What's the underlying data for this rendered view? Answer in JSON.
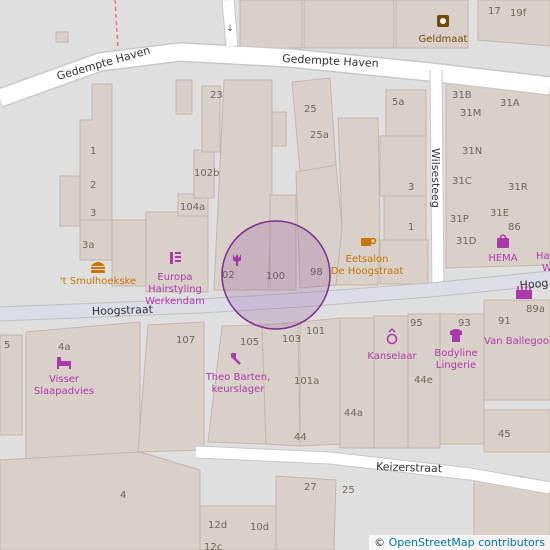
{
  "map": {
    "roads": [
      {
        "name": "Gedempte Haven",
        "label": "Gedempte Haven"
      },
      {
        "name": "Hoogstraat",
        "label": "Hoogstraat"
      },
      {
        "name": "Hoogstraat-east",
        "label": "Hoog"
      },
      {
        "name": "Wilsesteeg",
        "label": "Wilsesteeg"
      },
      {
        "name": "Keizerstraat",
        "label": "Keizerstraat"
      }
    ],
    "house_numbers": [
      "17",
      "19f",
      "23",
      "25",
      "25a",
      "5a",
      "31B",
      "31A",
      "31M",
      "1",
      "2",
      "3",
      "3a",
      "102b",
      "104a",
      "31N",
      "31C",
      "31R",
      "3",
      "1",
      "31P",
      "31E",
      "86",
      "31D",
      "02",
      "100",
      "98",
      "89a",
      "107",
      "105",
      "103",
      "101",
      "95",
      "93",
      "91",
      "5",
      "4a",
      "101a",
      "44e",
      "44a",
      "44",
      "45",
      "4",
      "27",
      "25",
      "12d",
      "10d",
      "12c"
    ],
    "pois": [
      {
        "name": "Geldmaat",
        "icon": "bank-icon",
        "color": "#734a08"
      },
      {
        "name": "'t Smulhoekske",
        "icon": "fastfood-icon",
        "color": "#c77400"
      },
      {
        "name": "Europa Hairstyling Werkendam",
        "lines": [
          "Europa",
          "Hairstyling",
          "Werkendam"
        ],
        "icon": "hairdresser-icon",
        "color": "#ac39ac"
      },
      {
        "name": "Eetsalon De Hoogstraat",
        "lines": [
          "Eetsalon",
          "De Hoogstraat"
        ],
        "icon": "cafe-icon",
        "color": "#c77400"
      },
      {
        "name": "HEMA",
        "icon": "department-store-icon",
        "color": "#ac39ac"
      },
      {
        "name": "Haz",
        "lines": [
          "Ha",
          "W"
        ],
        "icon": "",
        "color": "#ac39ac"
      },
      {
        "name": "Kanselaar",
        "icon": "jewelry-icon",
        "color": "#ac39ac"
      },
      {
        "name": "Bodyline Lingerie",
        "lines": [
          "Bodyline",
          "Lingerie"
        ],
        "icon": "clothes-icon",
        "color": "#ac39ac"
      },
      {
        "name": "Van Ballegooij",
        "icon": "shop-icon",
        "color": "#ac39ac"
      },
      {
        "name": "Visser Slaapadvies",
        "lines": [
          "Visser",
          "Slaapadvies"
        ],
        "icon": "bed-icon",
        "color": "#ac39ac"
      },
      {
        "name": "Theo Barten, keurslager",
        "lines": [
          "Theo Barten,",
          "keurslager"
        ],
        "icon": "butcher-icon",
        "color": "#ac39ac"
      },
      {
        "name": "flower",
        "icon": "florist-icon",
        "color": "#ac39ac"
      }
    ],
    "marker": {
      "type": "circle",
      "color": "#7b2d8b"
    },
    "colors": {
      "background": "#e0dfdf",
      "building": "#d9d0c9",
      "road": "#ffffff",
      "pedestrian": "#dddde8",
      "boundary": "#ff6b6b"
    }
  },
  "attribution": {
    "symbol": "©",
    "text": "OpenStreetMap contributors"
  }
}
